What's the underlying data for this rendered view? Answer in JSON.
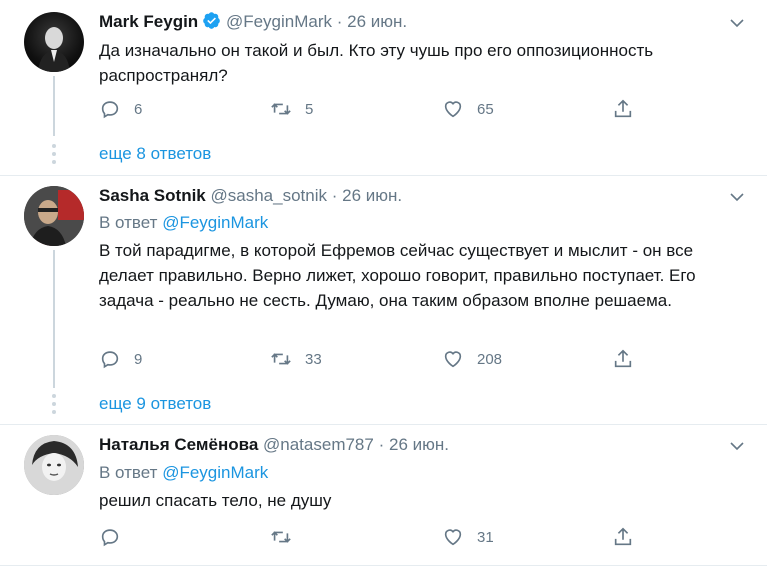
{
  "tweets": [
    {
      "name": "Mark Feygin",
      "verified": true,
      "handle": "@FeyginMark",
      "sep": "·",
      "date": "26 июн.",
      "reply_prefix": "",
      "reply_to": "",
      "text": "Да изначально он такой и был. Кто эту чушь про его оппозиционность распространял?",
      "replies": "6",
      "retweets": "5",
      "likes": "65",
      "more_replies": "еще 8 ответов"
    },
    {
      "name": "Sasha Sotnik",
      "verified": false,
      "handle": "@sasha_sotnik",
      "sep": "·",
      "date": "26 июн.",
      "reply_prefix": "В ответ",
      "reply_to": "@FeyginMark",
      "text": "В той парадигме, в которой Ефремов сейчас существует и мыслит - он все делает правильно. Верно лижет, хорошо говорит, правильно поступает. Его задача - реально не сесть. Думаю, она таким образом вполне решаема.",
      "replies": "9",
      "retweets": "33",
      "likes": "208",
      "more_replies": "еще 9 ответов"
    },
    {
      "name": "Наталья Семёнова",
      "verified": false,
      "handle": "@natasem787",
      "sep": "·",
      "date": "26 июн.",
      "reply_prefix": "В ответ",
      "reply_to": "@FeyginMark",
      "text": "решил спасать тело, не душу",
      "replies": "",
      "retweets": "",
      "likes": "31",
      "more_replies": ""
    }
  ],
  "colors": {
    "link": "#1b95e0",
    "muted": "#657786",
    "text": "#14171a",
    "verified": "#1da1f2",
    "divider": "#e6ecf0"
  }
}
